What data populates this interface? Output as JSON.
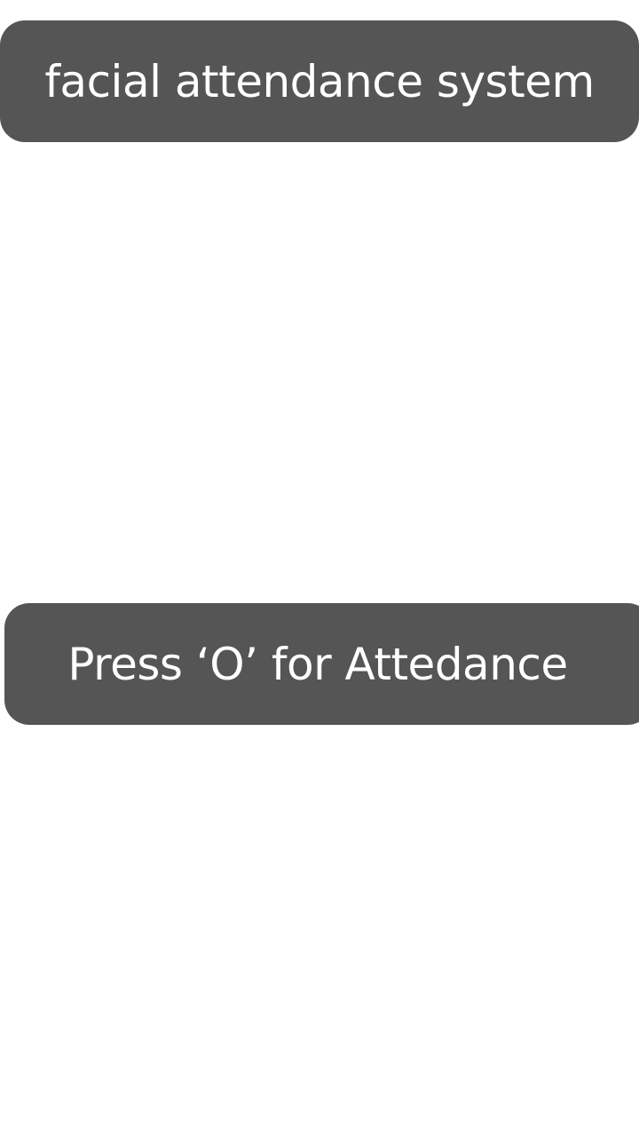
{
  "header": {
    "title": "facial attendance system"
  },
  "main": {
    "attendance_prompt": "Press ‘O’ for Attedance"
  },
  "colors": {
    "background": "#ffffff",
    "pill": "#555555",
    "text": "#ffffff"
  }
}
